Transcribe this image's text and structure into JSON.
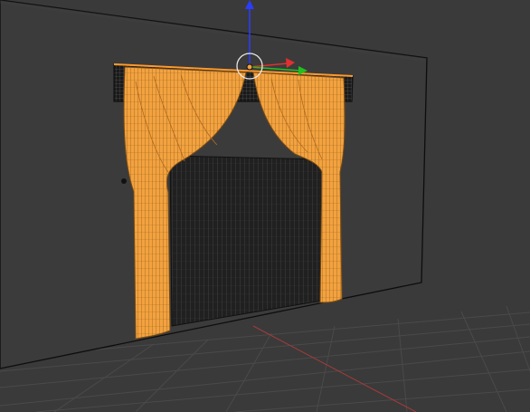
{
  "viewport": {
    "view": "perspective",
    "shading": "wireframe",
    "colors": {
      "background": "#3a3a3a",
      "wall": "#3b3b3b",
      "floor_grid": "#4c4c4c",
      "x_axis": "#a63a3a",
      "curtain_fill": "#f3a23f",
      "curtain_wire": "#8a5a1c",
      "selection": "#ff9a2e"
    }
  },
  "scene": {
    "selected_object": "curtain",
    "objects": [
      "wall",
      "curtain-rod",
      "left-curtain-panel",
      "right-curtain-panel",
      "inner-sheer",
      "floor-grid"
    ]
  },
  "gizmo": {
    "icons": [
      "rotate-ring-icon",
      "x-axis-arrow-icon",
      "y-axis-arrow-icon",
      "z-axis-arrow-icon"
    ],
    "colors": {
      "x": "#e03030",
      "y": "#20c020",
      "z": "#2a3cff",
      "ring": "#e8e8e8"
    }
  }
}
